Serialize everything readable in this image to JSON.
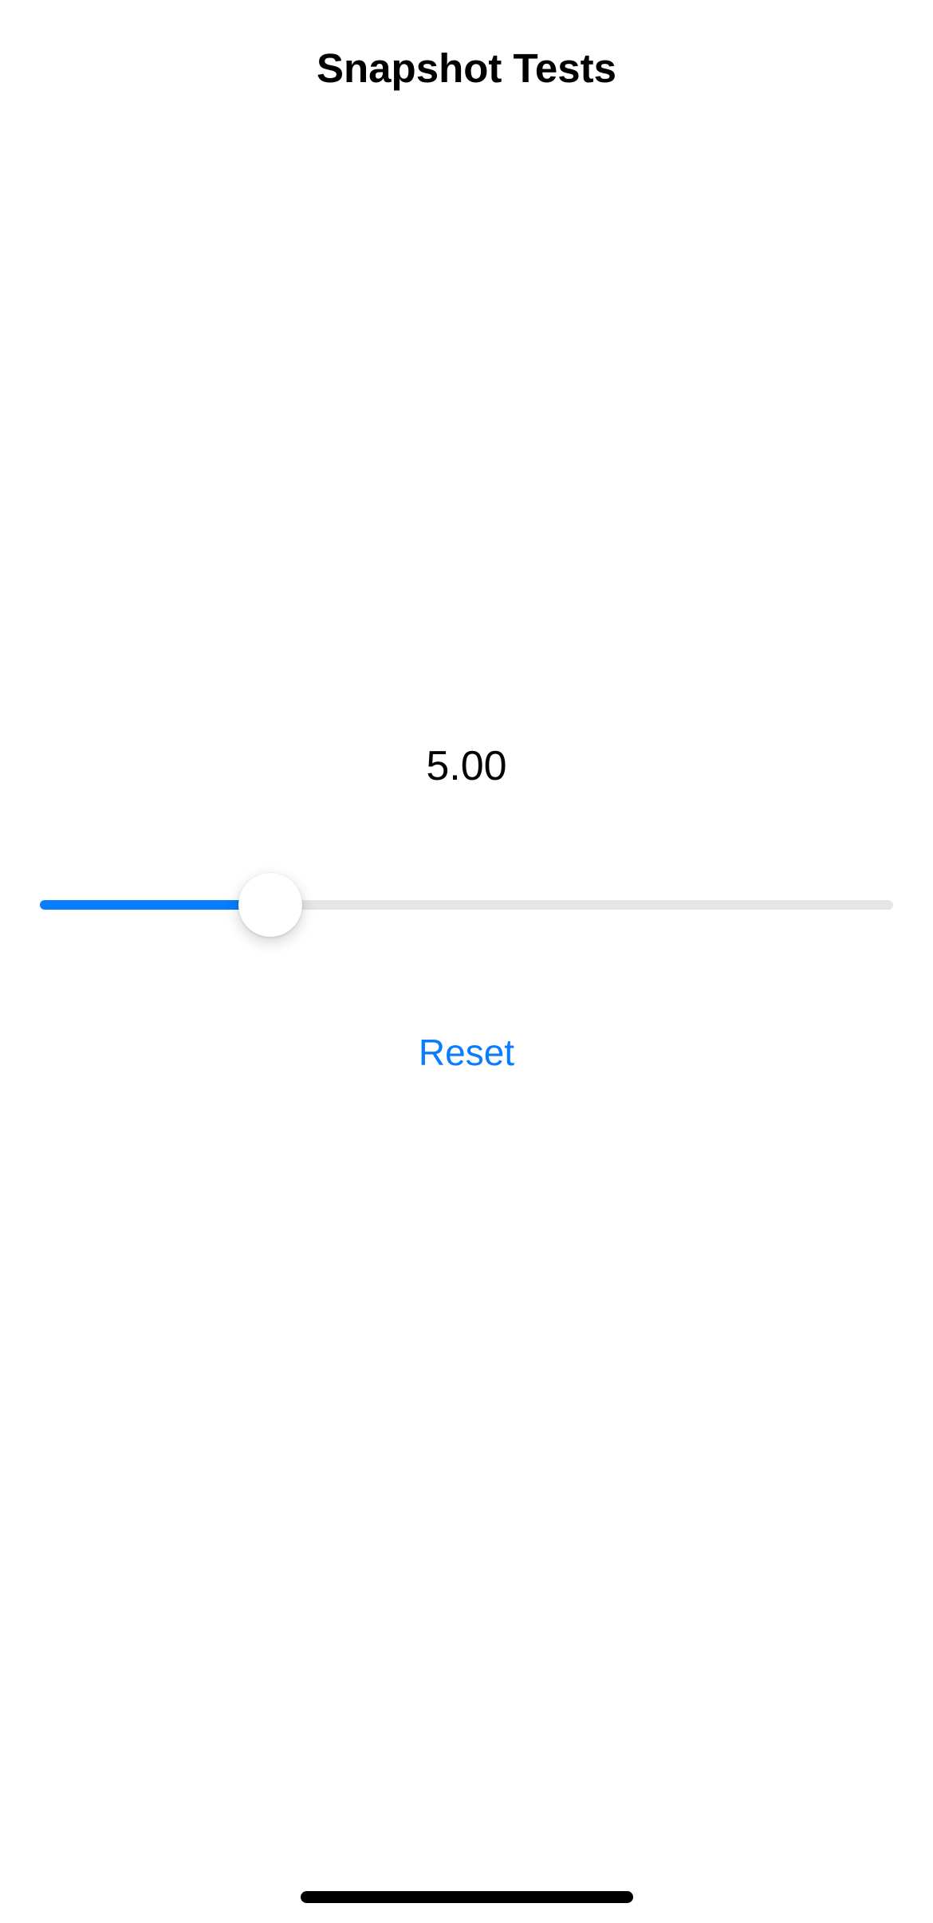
{
  "navbar": {
    "title": "Snapshot Tests"
  },
  "slider": {
    "value_label": "5.00",
    "fraction": 0.27
  },
  "reset_button": {
    "label": "Reset"
  },
  "colors": {
    "accent": "#0a7cff",
    "track": "#e5e5ea",
    "text": "#000000"
  }
}
